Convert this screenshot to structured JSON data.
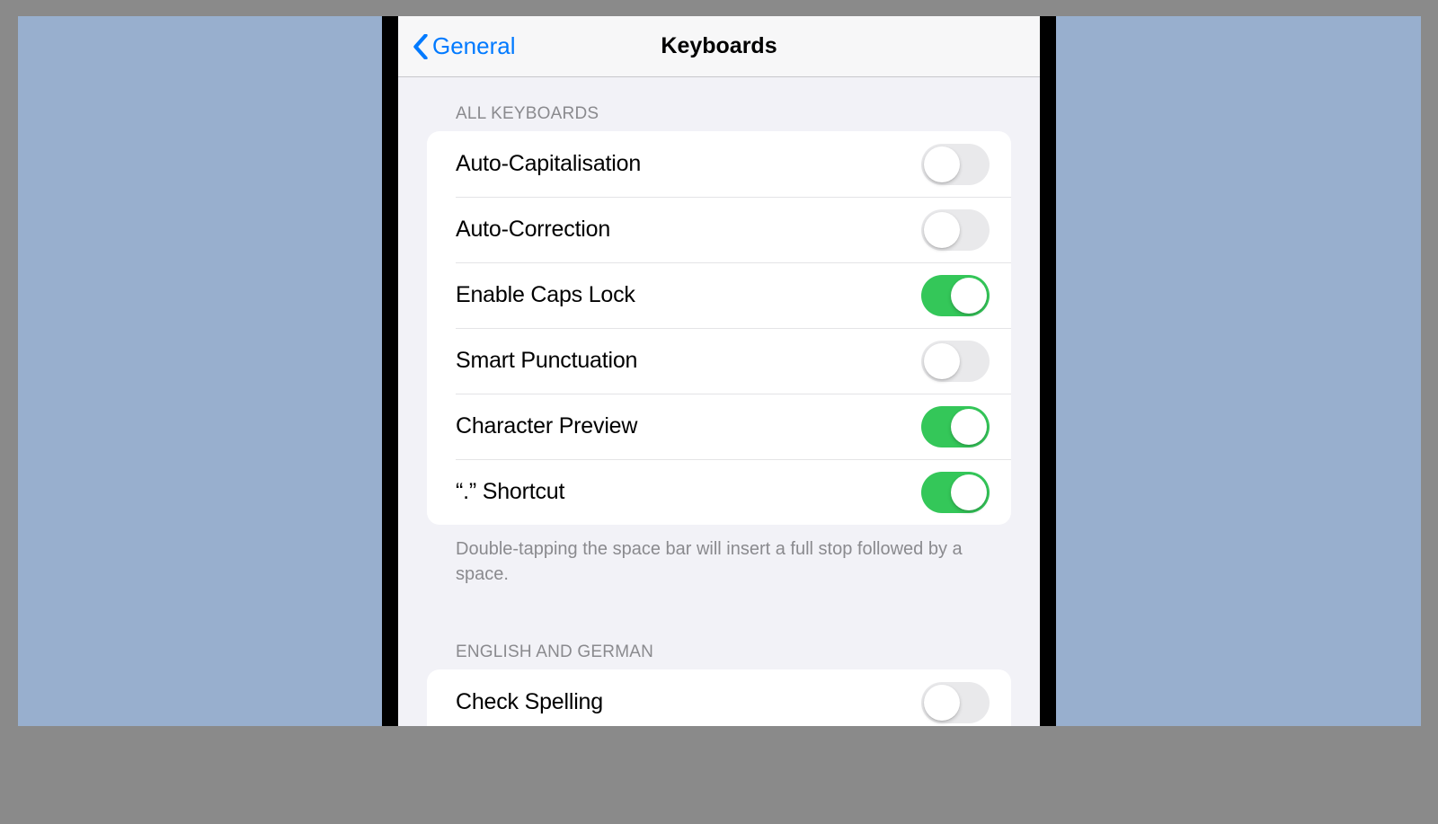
{
  "nav": {
    "back_label": "General",
    "title": "Keyboards"
  },
  "sections": {
    "all_keyboards": {
      "header": "ALL KEYBOARDS",
      "rows": {
        "auto_cap": {
          "label": "Auto-Capitalisation",
          "on": false
        },
        "auto_corr": {
          "label": "Auto-Correction",
          "on": false
        },
        "caps_lock": {
          "label": "Enable Caps Lock",
          "on": true
        },
        "smart_punc": {
          "label": "Smart Punctuation",
          "on": false
        },
        "char_preview": {
          "label": "Character Preview",
          "on": true
        },
        "dot_shortcut": {
          "label": "“.” Shortcut",
          "on": true
        }
      },
      "footer": "Double-tapping the space bar will insert a full stop followed by a space."
    },
    "lang": {
      "header": "ENGLISH AND GERMAN",
      "rows": {
        "check_spelling": {
          "label": "Check Spelling",
          "on": false
        }
      }
    }
  },
  "colors": {
    "accent_blue": "#007aff",
    "toggle_on": "#34c759",
    "toggle_off": "#e9e9eb",
    "bg": "#f2f2f7"
  }
}
